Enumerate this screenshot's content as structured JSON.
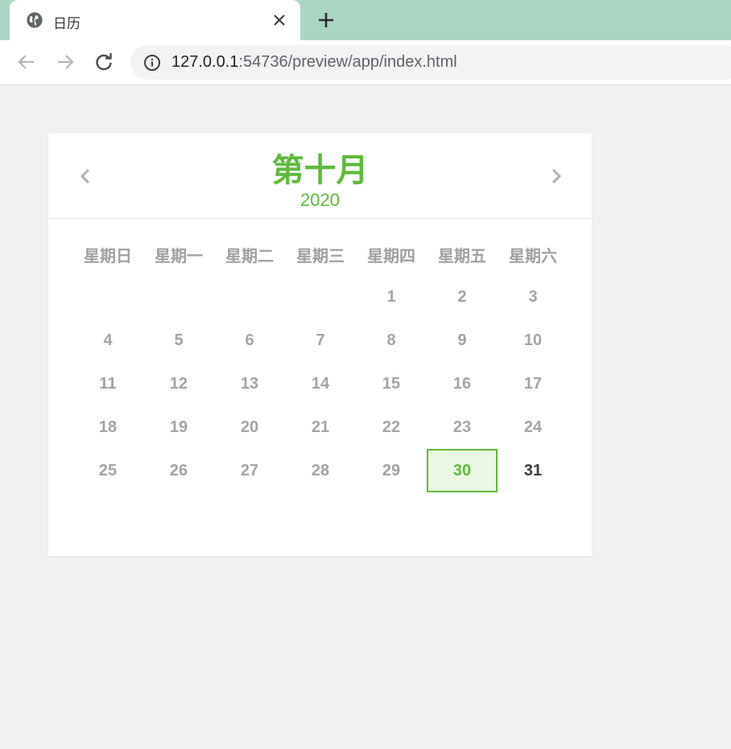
{
  "browser": {
    "tab_title": "日历",
    "url_host": "127.0.0.1",
    "url_path": ":54736/preview/app/index.html"
  },
  "calendar": {
    "month": "第十月",
    "year": "2020",
    "weekdays": [
      "星期日",
      "星期一",
      "星期二",
      "星期三",
      "星期四",
      "星期五",
      "星期六"
    ],
    "first_weekday_index": 4,
    "days_in_month": 31,
    "today": 30,
    "accent_color": "#5cbb3a"
  }
}
